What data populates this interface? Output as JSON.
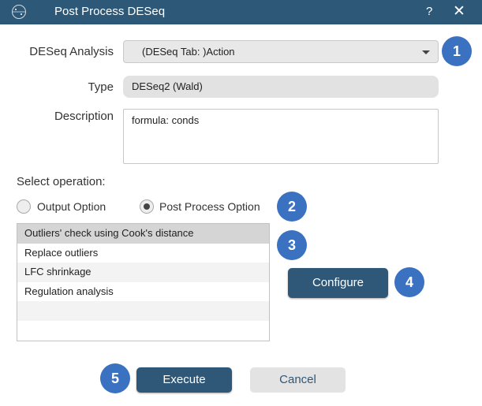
{
  "window": {
    "title": "Post Process DESeq",
    "help_label": "?",
    "close_label": "✕"
  },
  "form": {
    "analysis_label": "DESeq Analysis",
    "analysis_value": "(DESeq Tab: )Action",
    "type_label": "Type",
    "type_value": "DESeq2 (Wald)",
    "description_label": "Description",
    "description_value": "formula: conds"
  },
  "operation": {
    "heading": "Select operation:",
    "options": [
      {
        "label": "Output Option",
        "checked": false
      },
      {
        "label": "Post Process Option",
        "checked": true
      }
    ]
  },
  "list": {
    "items": [
      "Outliers' check using Cook's distance",
      "Replace outliers",
      "LFC shrinkage",
      "Regulation analysis"
    ],
    "selected_index": 0
  },
  "buttons": {
    "configure": "Configure",
    "execute": "Execute",
    "cancel": "Cancel"
  },
  "badges": [
    "1",
    "2",
    "3",
    "4",
    "5"
  ],
  "colors": {
    "titlebar": "#2d5878",
    "primary_button": "#2f5777",
    "badge": "#3a71c0"
  }
}
